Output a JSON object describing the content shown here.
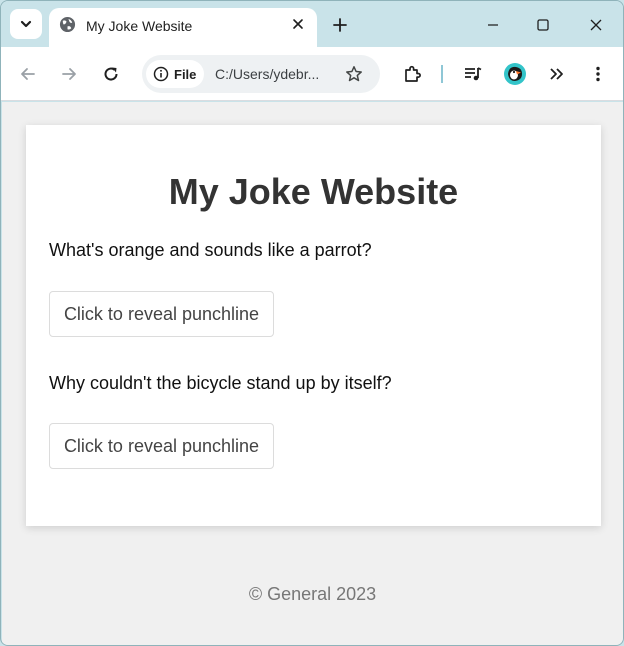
{
  "browser": {
    "tab": {
      "title": "My Joke Website"
    },
    "address_bar": {
      "scheme_chip": "File",
      "url": "C:/Users/ydebr..."
    },
    "icons": {
      "tab_search": "chevron-down-icon",
      "favicon": "globe-icon",
      "tab_close": "close-icon",
      "new_tab": "plus-icon",
      "minimize": "minimize-icon",
      "maximize": "maximize-icon",
      "close_window": "close-icon",
      "back": "arrow-left-icon",
      "forward": "arrow-right-icon",
      "reload": "reload-icon",
      "site_info": "info-icon",
      "bookmark": "star-icon",
      "extensions": "puzzle-icon",
      "media": "music-queue-icon",
      "profile": "puffin-avatar-icon",
      "more_tools": "double-chevron-icon",
      "menu": "vertical-dots-icon"
    }
  },
  "page": {
    "title": "My Joke Website",
    "jokes": [
      {
        "question": "What's orange and sounds like a parrot?",
        "button_label": "Click to reveal punchline"
      },
      {
        "question": "Why couldn't the bicycle stand up by itself?",
        "button_label": "Click to reveal punchline"
      }
    ],
    "footer": "© General 2023"
  },
  "colors": {
    "chrome_frame": "#c9e3e9",
    "page_background": "#f0f0f0",
    "card_background": "#ffffff",
    "title_text": "#333333",
    "footer_text": "#777777"
  }
}
